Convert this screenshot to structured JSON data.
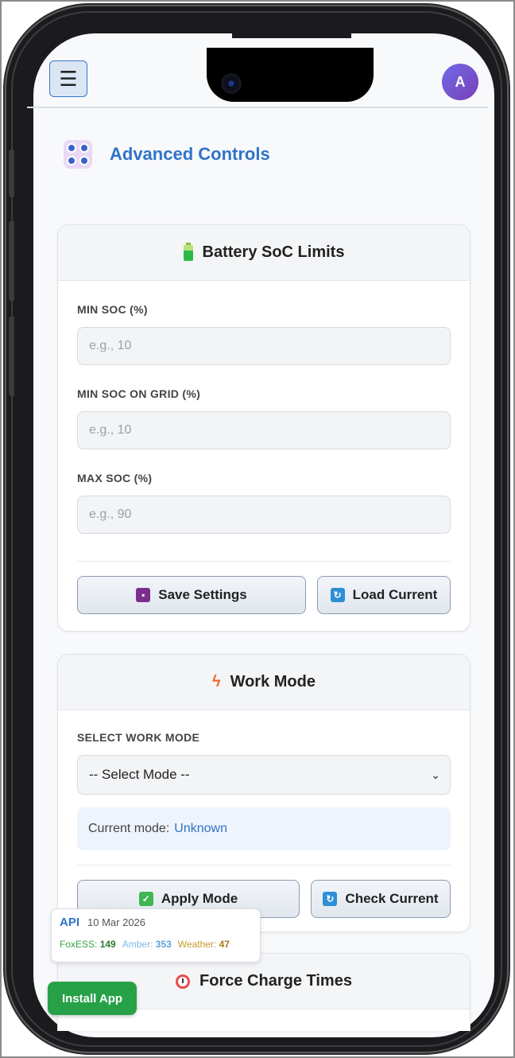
{
  "header": {
    "menu_glyph": "☰",
    "avatar_initial": "A"
  },
  "page": {
    "title": "Advanced Controls"
  },
  "soc_card": {
    "title": "Battery SoC Limits",
    "fields": [
      {
        "label": "MIN SOC (%)",
        "placeholder": "e.g., 10"
      },
      {
        "label": "MIN SOC ON GRID (%)",
        "placeholder": "e.g., 10"
      },
      {
        "label": "MAX SOC (%)",
        "placeholder": "e.g., 90"
      }
    ],
    "save_label": "Save Settings",
    "load_label": "Load Current"
  },
  "work_mode_card": {
    "title": "Work Mode",
    "select_label": "SELECT WORK MODE",
    "selected_value": "-- Select Mode --",
    "current_mode_prefix": "Current mode:",
    "current_mode_value": "Unknown",
    "apply_label": "Apply Mode",
    "check_label": "Check Current"
  },
  "force_charge_card": {
    "title": "Force Charge Times"
  },
  "api_badge": {
    "label": "API",
    "date": "10 Mar 2026",
    "foxess_label": "FoxESS:",
    "foxess_value": "149",
    "amber_label": "Amber:",
    "amber_value": "353",
    "weather_label": "Weather:",
    "weather_value": "47"
  },
  "install": {
    "label": "Install App"
  },
  "colors": {
    "accent": "#2f73c9",
    "install_green": "#27a148"
  }
}
